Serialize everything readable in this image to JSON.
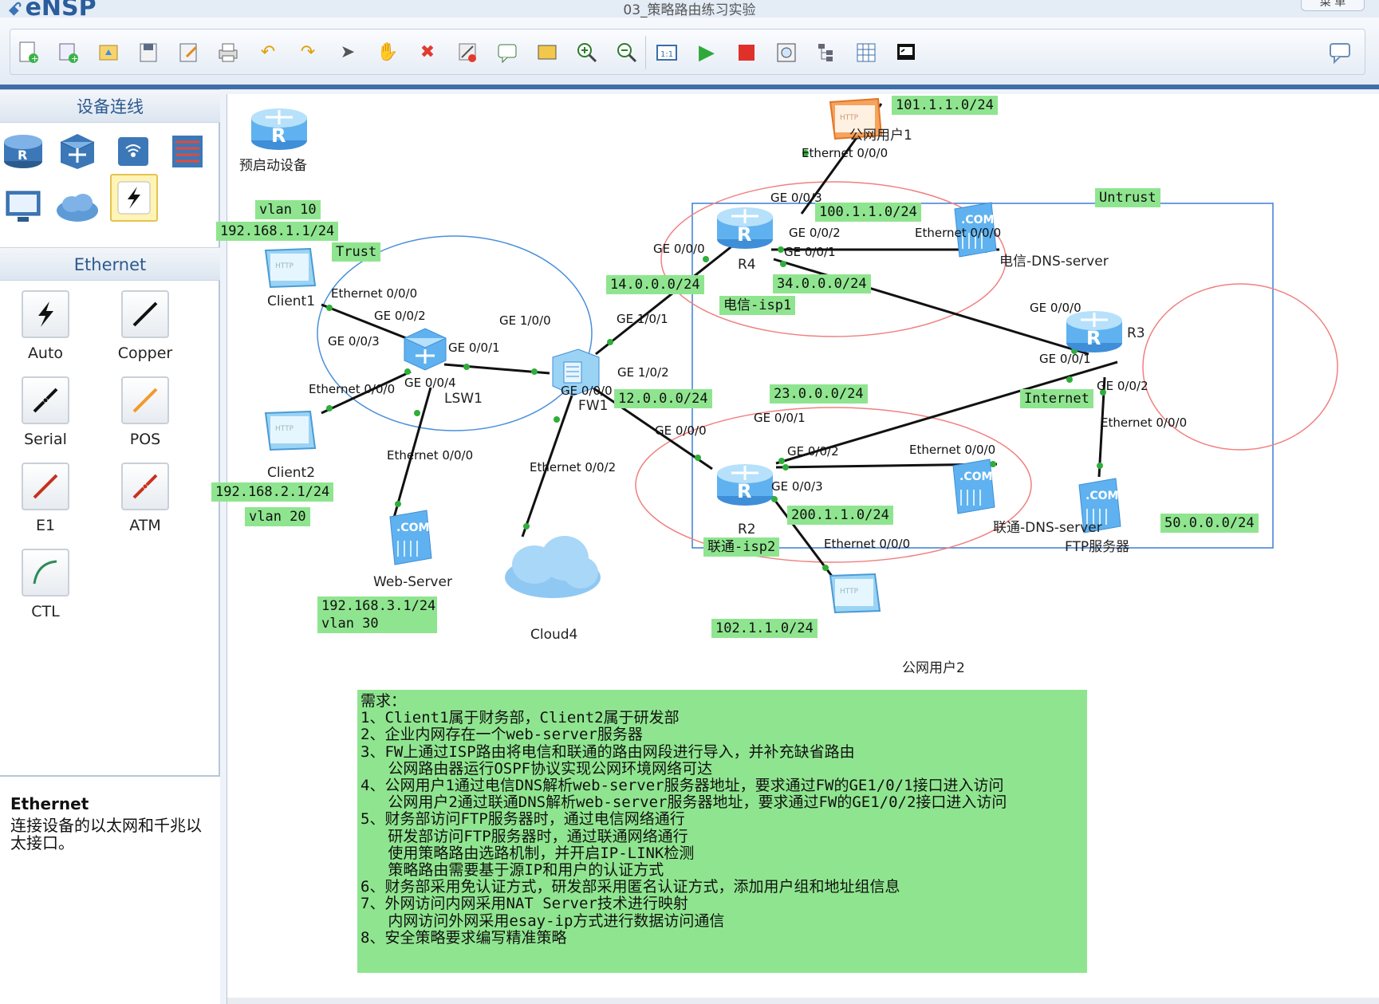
{
  "app": {
    "name": "eNSP",
    "window_title": "03_策略路由练习实验",
    "menu_label": "菜 单"
  },
  "toolbar": {
    "buttons": [
      "new-topology",
      "new-device",
      "open",
      "save",
      "save-as",
      "print",
      "undo",
      "redo",
      "select",
      "pan",
      "delete",
      "delete-link",
      "text",
      "palette",
      "zoom-in",
      "zoom-out",
      "fit",
      "start",
      "stop",
      "capture",
      "topology-view",
      "grid",
      "console",
      "chat"
    ]
  },
  "left": {
    "device_header": "设备连线",
    "ethernet_header": "Ethernet",
    "links": [
      {
        "label": "Auto"
      },
      {
        "label": "Copper"
      },
      {
        "label": "Serial"
      },
      {
        "label": "POS"
      },
      {
        "label": "E1"
      },
      {
        "label": "ATM"
      },
      {
        "label": "CTL"
      }
    ],
    "desc_title": "Ethernet",
    "desc_text": "连接设备的以太网和千兆以太接口。"
  },
  "topology": {
    "devices": {
      "preboot": "预启动设备",
      "client1": "Client1",
      "client2": "Client2",
      "lsw1": "LSW1",
      "fw1": "FW1",
      "web": "Web-Server",
      "cloud": "Cloud4",
      "r4": "R4",
      "r2": "R2",
      "r3": "R3",
      "pub1": "公网用户1",
      "pub2": "公网用户2",
      "dns_dx": "电信-DNS-server",
      "dns_lt": "联通-DNS-server",
      "ftp": "FTP服务器"
    },
    "tags": {
      "vlan10": "vlan 10",
      "net_c1": "192.168.1.1/24",
      "trust": "Trust",
      "net_c2": "192.168.2.1/24",
      "vlan20": "vlan 20",
      "net_web": "192.168.3.1/24",
      "vlan30": "vlan 30",
      "net_101": "101.1.1.0/24",
      "net_100": "100.1.1.0/24",
      "untrust": "Untrust",
      "net_14": "14.0.0.0/24",
      "net_34": "34.0.0.0/24",
      "isp1": "电信-isp1",
      "net_12": "12.0.0.0/24",
      "net_23": "23.0.0.0/24",
      "internet": "Internet",
      "net_200": "200.1.1.0/24",
      "isp2": "联通-isp2",
      "net_102": "102.1.1.0/24",
      "net_50": "50.0.0.0/24"
    },
    "ports": {
      "c1_e000": "Ethernet 0/0/0",
      "lsw_g002": "GE 0/0/2",
      "lsw_g003": "GE 0/0/3",
      "c2_e000": "Ethernet 0/0/0",
      "lsw_g001": "GE 0/0/1",
      "lsw_g004": "GE 0/0/4",
      "web_e000": "Ethernet 0/0/0",
      "fw_g100": "GE 1/0/0",
      "fw_g101": "GE 1/0/1",
      "fw_g102": "GE 1/0/2",
      "fw_g000": "GE 0/0/0",
      "cloud_e002": "Ethernet 0/0/2",
      "pub1_e000": "Ethernet 0/0/0",
      "r4_g003": "GE 0/0/3",
      "r4_g000": "GE 0/0/0",
      "r4_g002": "GE 0/0/2",
      "r4_g001": "GE 0/0/1",
      "dnsdx_e000": "Ethernet 0/0/0",
      "r3_g000": "GE 0/0/0",
      "r3_g001": "GE 0/0/1",
      "r3_g002": "GE 0/0/2",
      "ftp_e000": "Ethernet 0/0/0",
      "r2_g001": "GE 0/0/1",
      "r2_g000": "GE 0/0/0",
      "r2_g002": "GE 0/0/2",
      "r2_g003": "GE 0/0/3",
      "dnslt_e000": "Ethernet 0/0/0",
      "pub2_e000": "Ethernet 0/0/0"
    },
    "notes": "需求：\n1、Client1属于财务部，Client2属于研发部\n2、企业内网存在一个web-server服务器\n3、FW上通过ISP路由将电信和联通的路由网段进行导入，并补充缺省路由\n   公网路由器运行OSPF协议实现公网环境网络可达\n4、公网用户1通过电信DNS解析web-server服务器地址，要求通过FW的GE1/0/1接口进入访问\n   公网用户2通过联通DNS解析web-server服务器地址，要求通过FW的GE1/0/2接口进入访问\n5、财务部访问FTP服务器时，通过电信网络通行\n   研发部访问FTP服务器时，通过联通网络通行\n   使用策略路由选路机制，并开启IP-LINK检测\n   策略路由需要基于源IP和用户的认证方式\n6、财务部采用免认证方式，研发部采用匿名认证方式，添加用户组和地址组信息\n7、外网访问内网采用NAT Server技术进行映射\n   内网访问外网采用esay-ip方式进行数据访问通信\n8、安全策略要求编写精准策略"
  },
  "colors": {
    "accent": "#3f6ea8",
    "tag_green": "#8fe58f",
    "trust_circle": "#4a90d9",
    "isp_circle": "#f08080",
    "zone_box": "#3a7fd5"
  }
}
